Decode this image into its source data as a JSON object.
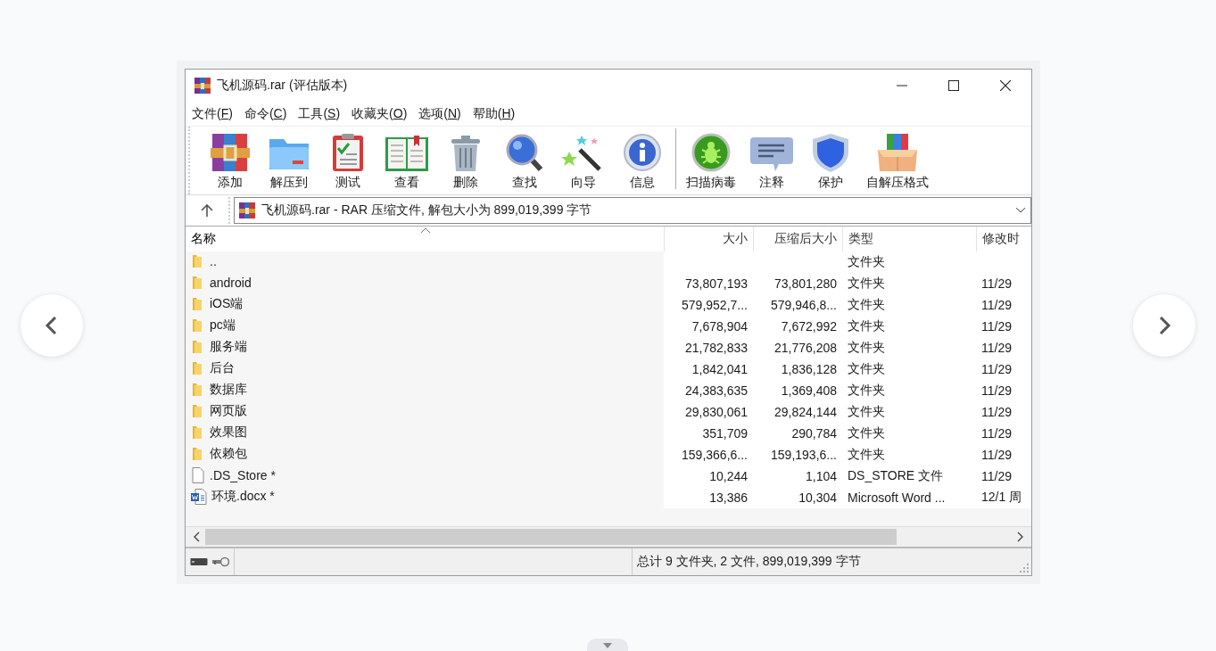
{
  "window": {
    "title": "飞机源码.rar (评估版本)"
  },
  "menu": [
    "文件(F)",
    "命令(C)",
    "工具(S)",
    "收藏夹(O)",
    "选项(N)",
    "帮助(H)"
  ],
  "toolbar": {
    "groups": [
      [
        "添加",
        "解压到",
        "测试",
        "查看",
        "删除",
        "查找",
        "向导",
        "信息"
      ],
      [
        "扫描病毒",
        "注释",
        "保护",
        "自解压格式"
      ]
    ]
  },
  "address": {
    "value": "飞机源码.rar - RAR 压缩文件, 解包大小为 899,019,399 字节"
  },
  "table": {
    "columns": [
      {
        "label": "名称",
        "sorted": true
      },
      {
        "label": "大小",
        "sorted": false
      },
      {
        "label": "压缩后大小",
        "sorted": false
      },
      {
        "label": "类型",
        "sorted": false
      },
      {
        "label": "修改时",
        "sorted": false
      }
    ],
    "rows": [
      {
        "kind": "folder",
        "name": "..",
        "size": "",
        "packed": "",
        "type": "文件夹",
        "modified": ""
      },
      {
        "kind": "folder",
        "name": "android",
        "size": "73,807,193",
        "packed": "73,801,280",
        "type": "文件夹",
        "modified": "11/29"
      },
      {
        "kind": "folder",
        "name": "iOS端",
        "size": "579,952,7...",
        "packed": "579,946,8...",
        "type": "文件夹",
        "modified": "11/29"
      },
      {
        "kind": "folder",
        "name": "pc端",
        "size": "7,678,904",
        "packed": "7,672,992",
        "type": "文件夹",
        "modified": "11/29"
      },
      {
        "kind": "folder",
        "name": "服务端",
        "size": "21,782,833",
        "packed": "21,776,208",
        "type": "文件夹",
        "modified": "11/29"
      },
      {
        "kind": "folder",
        "name": "后台",
        "size": "1,842,041",
        "packed": "1,836,128",
        "type": "文件夹",
        "modified": "11/29"
      },
      {
        "kind": "folder",
        "name": "数据库",
        "size": "24,383,635",
        "packed": "1,369,408",
        "type": "文件夹",
        "modified": "11/29"
      },
      {
        "kind": "folder",
        "name": "网页版",
        "size": "29,830,061",
        "packed": "29,824,144",
        "type": "文件夹",
        "modified": "11/29"
      },
      {
        "kind": "folder",
        "name": "效果图",
        "size": "351,709",
        "packed": "290,784",
        "type": "文件夹",
        "modified": "11/29"
      },
      {
        "kind": "folder",
        "name": "依赖包",
        "size": "159,366,6...",
        "packed": "159,193,6...",
        "type": "文件夹",
        "modified": "11/29"
      },
      {
        "kind": "file",
        "name": ".DS_Store *",
        "size": "10,244",
        "packed": "1,104",
        "type": "DS_STORE 文件",
        "modified": "11/29"
      },
      {
        "kind": "word",
        "name": "环境.docx *",
        "size": "13,386",
        "packed": "10,304",
        "type": "Microsoft Word ...",
        "modified": "12/1 周"
      }
    ]
  },
  "status_bar": {
    "text": "总计 9 文件夹, 2 文件, 899,019,399 字节"
  }
}
